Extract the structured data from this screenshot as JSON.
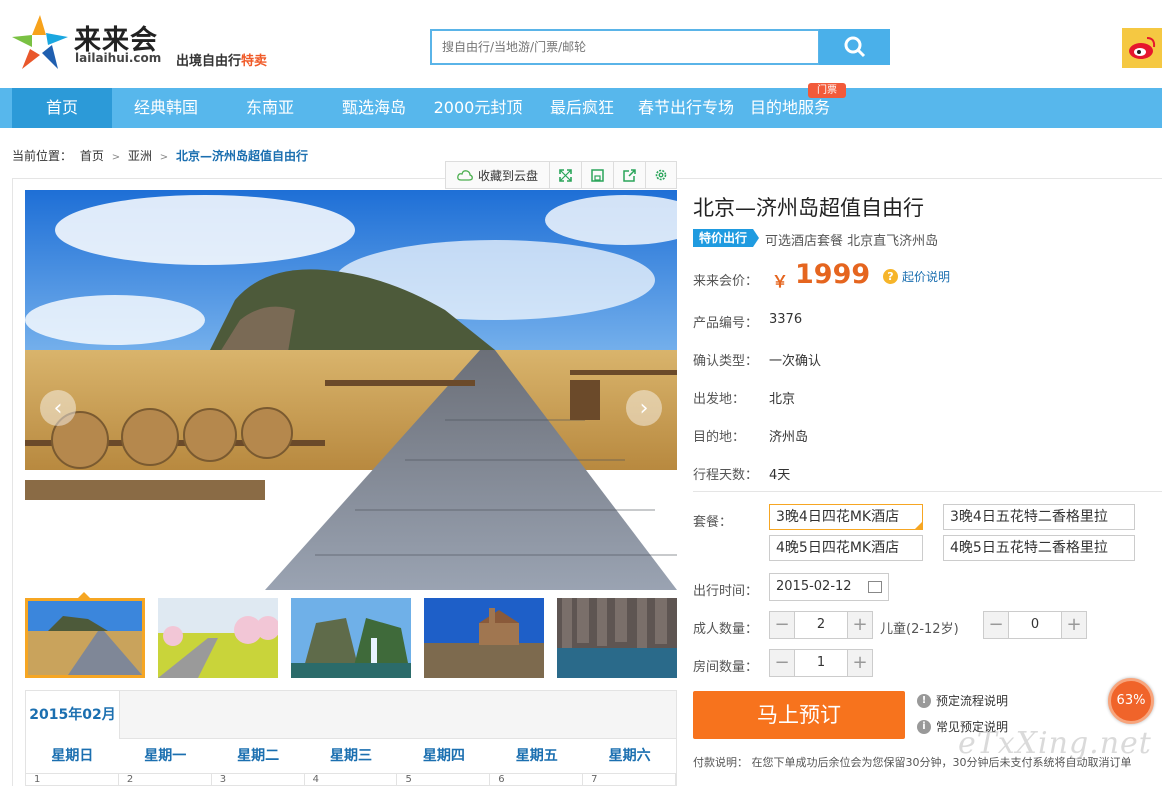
{
  "header": {
    "logo_name": "来来会",
    "logo_domain": "lailaihui.com",
    "slogan_main": "出境自由行",
    "slogan_hot": "特卖",
    "search_placeholder": "搜自由行/当地游/门票/邮轮"
  },
  "nav": {
    "items": [
      "首页",
      "经典韩国",
      "东南亚",
      "甄选海岛",
      "2000元封顶",
      "最后疯狂",
      "春节出行专场",
      "目的地服务"
    ],
    "active_index": 0,
    "badge": "门票"
  },
  "breadcrumb": {
    "prefix": "当前位置：",
    "items": [
      "首页",
      "亚洲"
    ],
    "current": "北京—济州岛超值自由行"
  },
  "toolbar": {
    "save_cloud": "收藏到云盘"
  },
  "product": {
    "title": "北京—济州岛超值自由行",
    "tag": "特价出行",
    "subtitle": "可选酒店套餐 北京直飞济州岛",
    "price_label": "来来会价：",
    "currency": "￥",
    "price": "1999",
    "price_help": "起价说明",
    "fields": [
      {
        "label": "产品编号：",
        "value": "3376"
      },
      {
        "label": "确认类型：",
        "value": "一次确认"
      },
      {
        "label": "出发地：",
        "value": "北京"
      },
      {
        "label": "目的地：",
        "value": "济州岛"
      },
      {
        "label": "行程天数：",
        "value": "4天"
      }
    ],
    "package_label": "套餐：",
    "packages": [
      "3晚4日四花MK酒店",
      "3晚4日五花特二香格里拉",
      "4晚5日四花MK酒店",
      "4晚5日五花特二香格里拉"
    ],
    "selected_package": 0,
    "date_label": "出行时间：",
    "date_value": "2015-02-12",
    "adult_label": "成人数量：",
    "adult_value": "2",
    "child_label": "儿童(2-12岁)",
    "child_value": "0",
    "room_label": "房间数量：",
    "room_value": "1",
    "book_button": "马上预订",
    "help_process": "预定流程说明",
    "help_faq": "常见预定说明",
    "payment_note": "付款说明： 在您下单成功后余位会为您保留30分钟，30分钟后未支付系统将自动取消订单"
  },
  "calendar": {
    "month_tab": "2015年02月",
    "weekdays": [
      "星期日",
      "星期一",
      "星期二",
      "星期三",
      "星期四",
      "星期五",
      "星期六"
    ],
    "first_row": [
      "1",
      "2",
      "3",
      "4",
      "5",
      "6",
      "7"
    ]
  },
  "progress": "63%",
  "watermark": "eTxXing.net",
  "colors": {
    "nav_bg": "#57b7ec",
    "nav_active": "#2c9ad8",
    "price": "#e5651f",
    "book_button": "#f7731d",
    "link": "#1b6fb0"
  }
}
